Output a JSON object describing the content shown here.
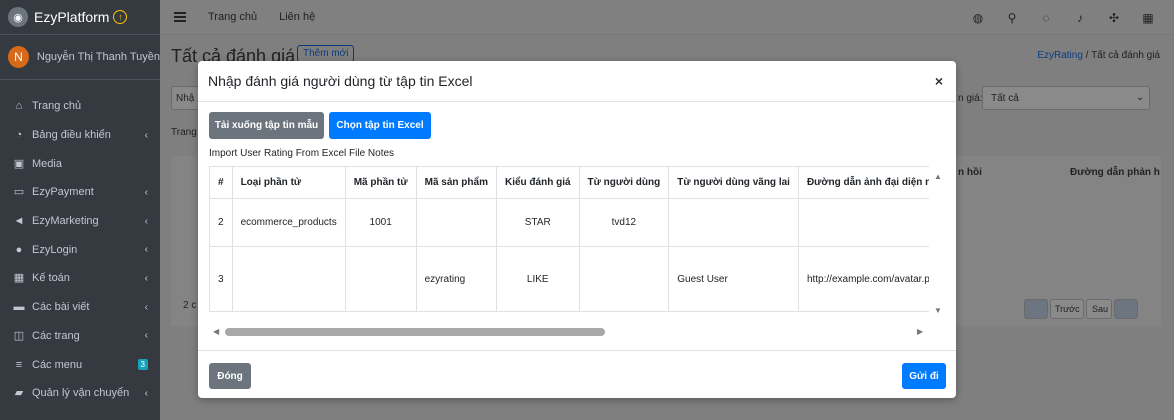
{
  "brand": {
    "name": "EzyPlatform"
  },
  "user": {
    "initial": "N",
    "name": "Nguyễn Thị Thanh Tuyền"
  },
  "sidebar": {
    "items": [
      {
        "label": "Trang chủ",
        "icon": "home-icon",
        "has_chevron": false
      },
      {
        "label": "Bảng điều khiển",
        "icon": "dashboard-icon",
        "has_chevron": true
      },
      {
        "label": "Media",
        "icon": "image-icon",
        "has_chevron": false
      },
      {
        "label": "EzyPayment",
        "icon": "payment-icon",
        "has_chevron": true
      },
      {
        "label": "EzyMarketing",
        "icon": "megaphone-icon",
        "has_chevron": true
      },
      {
        "label": "EzyLogin",
        "icon": "users-icon",
        "has_chevron": true
      },
      {
        "label": "Kế toán",
        "icon": "calculator-icon",
        "has_chevron": true
      },
      {
        "label": "Các bài viết",
        "icon": "posts-icon",
        "has_chevron": true
      },
      {
        "label": "Các trang",
        "icon": "pages-icon",
        "has_chevron": true
      },
      {
        "label": "Các menu",
        "icon": "menu-icon",
        "badge": "3"
      },
      {
        "label": "Quản lý vận chuyển",
        "icon": "truck-icon",
        "has_chevron": true
      }
    ]
  },
  "topbar": {
    "links": [
      "Trang chủ",
      "Liên hệ"
    ],
    "icons": [
      "globe-icon",
      "search-icon",
      "comments-icon",
      "bell-icon",
      "expand-icon",
      "grid-icon"
    ]
  },
  "page": {
    "title": "Tất cả đánh giá",
    "add_button": "Thêm mới",
    "breadcrumb": {
      "link": "EzyRating",
      "separator": "/",
      "current": "Tất cả đánh giá"
    },
    "filter_partial": "Nhậ",
    "filter_label_partial": "n giá:",
    "filter_value": "Tất cả",
    "trang_partial": "Trang",
    "count_partial": "2 c",
    "col_partial_1": "n hồi",
    "col_partial_2": "Đường dẫn phản h",
    "pagination": {
      "prev": "Trước",
      "next": "Sau"
    }
  },
  "modal": {
    "title": "Nhập đánh giá người dùng từ tập tin Excel",
    "close_label": "×",
    "download_button": "Tải xuống tập tin mẫu",
    "choose_button": "Chọn tập tin Excel",
    "notes": "Import User Rating From Excel File Notes",
    "table": {
      "headers": [
        "#",
        "Loại phần tử",
        "Mã phần tử",
        "Mã sản phẩm",
        "Kiểu đánh giá",
        "Từ người dùng",
        "Từ người dùng vãng lai",
        "Đường dẫn ảnh đại diện người"
      ],
      "rows": [
        [
          "2",
          "ecommerce_products",
          "1001",
          "",
          "STAR",
          "tvd12",
          "",
          ""
        ],
        [
          "3",
          "",
          "",
          "ezyrating",
          "LIKE",
          "",
          "Guest User",
          "http://example.com/avatar.png"
        ]
      ]
    },
    "close_button": "Đóng",
    "submit_button": "Gửi đi"
  }
}
